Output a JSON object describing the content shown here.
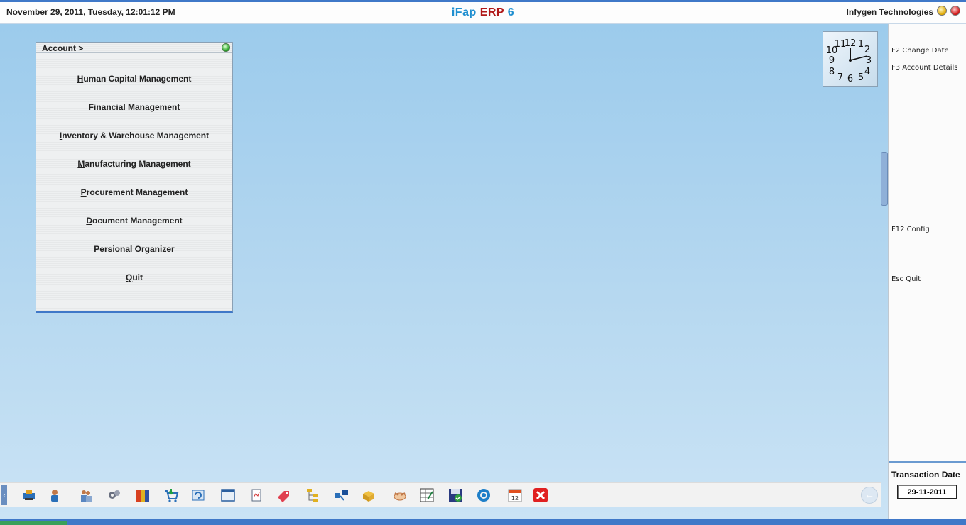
{
  "header": {
    "datetime": "November  29, 2011, Tuesday, 12:01:12 PM",
    "title_part1": "iFap ",
    "title_part2": "ERP",
    "title_part3": " 6",
    "company": "Infygen Technologies"
  },
  "menu": {
    "title": "Account >",
    "items": [
      {
        "key": "H",
        "rest": "uman Capital Management"
      },
      {
        "key": "F",
        "rest": "inancial Management"
      },
      {
        "key": "I",
        "rest": "nventory & Warehouse Management"
      },
      {
        "key": "M",
        "rest": "anufacturing Management"
      },
      {
        "key": "P",
        "rest": "rocurement Management"
      },
      {
        "key": "D",
        "rest": "ocument Management"
      },
      {
        "pre": "Persi",
        "key": "o",
        "rest": "nal Organizer"
      },
      {
        "key": "Q",
        "rest": "uit"
      }
    ]
  },
  "sidepanel": {
    "hotkeys": [
      "F2 Change Date",
      "F3 Account Details",
      "F12 Config",
      "Esc Quit"
    ],
    "transaction_label": "Transaction Date",
    "transaction_date": "29-11-2011"
  },
  "toolbar": {
    "icons": [
      "network-icon",
      "user-phone-icon",
      "people-icon",
      "gears-icon",
      "books-icon",
      "shopping-cart-icon",
      "refresh-icon",
      "window-icon",
      "document-icon",
      "sale-tag-icon",
      "tree-icon",
      "flow-icon",
      "package-icon",
      "handshake-icon",
      "checklist-icon",
      "save-icon",
      "settings-icon",
      "calendar-icon",
      "close-icon"
    ],
    "calendar_day": "12"
  },
  "colors": {
    "accent": "#3f78c8",
    "title_blue": "#1f8fd0",
    "title_red": "#b01818"
  }
}
